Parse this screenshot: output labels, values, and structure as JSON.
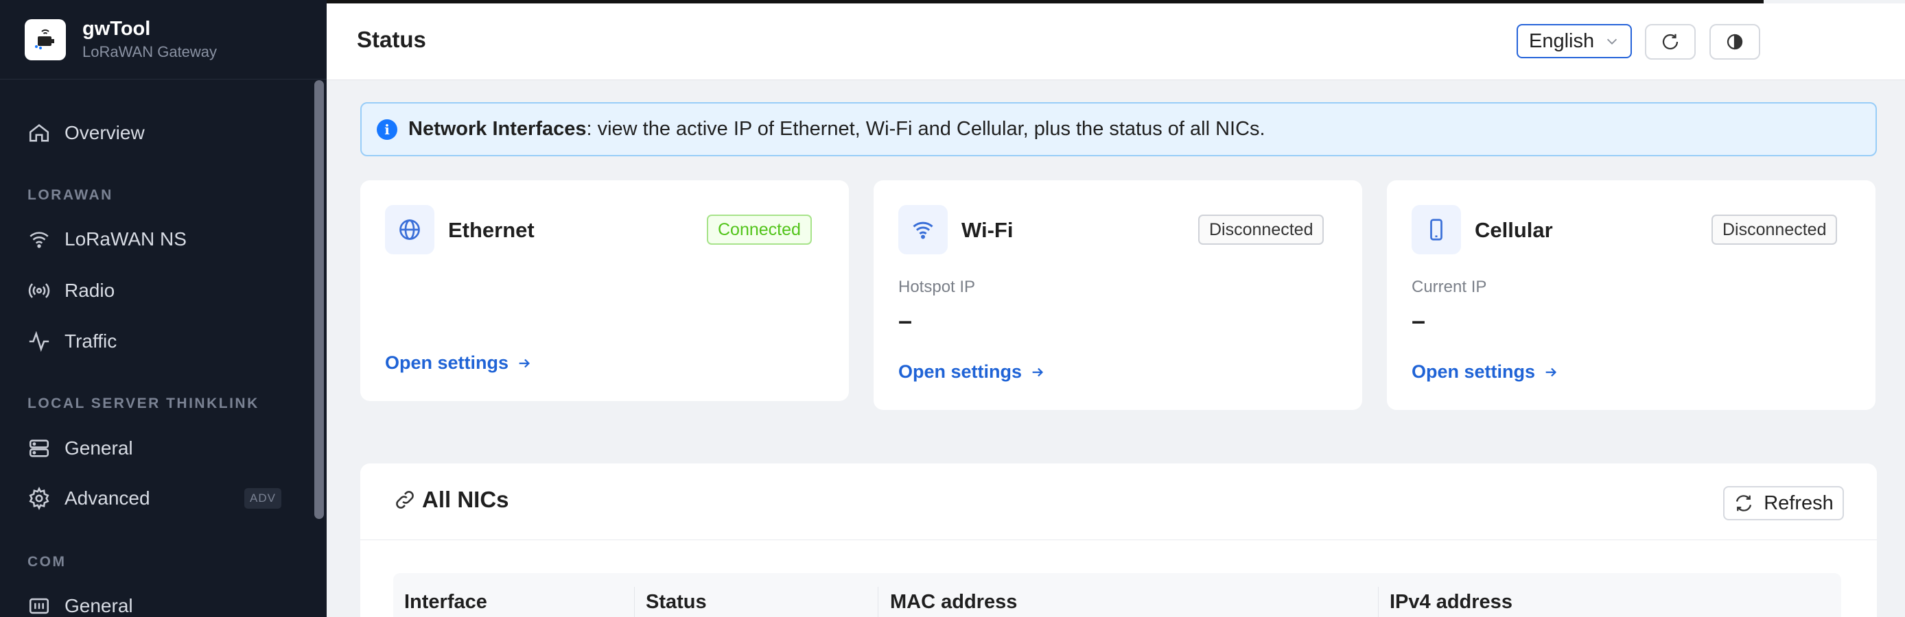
{
  "app": {
    "name": "gwTool",
    "subtitle": "LoRaWAN Gateway"
  },
  "sidebar": {
    "overview": "Overview",
    "sections": [
      {
        "title": "LORAWAN",
        "items": [
          "LoRaWAN NS",
          "Radio",
          "Traffic"
        ]
      },
      {
        "title": "LOCAL SERVER THINKLINK",
        "items": [
          "General",
          "Advanced"
        ]
      },
      {
        "title": "COM",
        "items": [
          "General"
        ]
      }
    ],
    "advanced_badge": "ADV"
  },
  "header": {
    "title": "Status",
    "language": "English"
  },
  "banner": {
    "bold": "Network Interfaces",
    "text": ": view the active IP of Ethernet, Wi-Fi and Cellular, plus the status of all NICs."
  },
  "cards": [
    {
      "title": "Ethernet",
      "status": "Connected",
      "link": "Open settings"
    },
    {
      "title": "Wi-Fi",
      "status": "Disconnected",
      "ip_label": "Hotspot IP",
      "ip_value": "–",
      "link": "Open settings"
    },
    {
      "title": "Cellular",
      "status": "Disconnected",
      "ip_label": "Current IP",
      "ip_value": "–",
      "link": "Open settings"
    }
  ],
  "nics": {
    "title": "All NICs",
    "refresh": "Refresh",
    "columns": [
      "Interface",
      "Status",
      "MAC address",
      "IPv4 address"
    ]
  },
  "colors": {
    "accent": "#2563d9",
    "link": "#1f63d6",
    "success": "#52c41a",
    "sidebar_bg": "#141a26"
  }
}
